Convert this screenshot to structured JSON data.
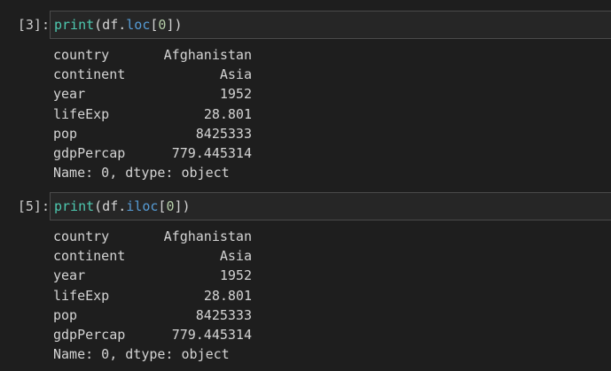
{
  "cells": [
    {
      "prompt": "[3]:",
      "code": {
        "fn": "print",
        "open": "(df.",
        "attr": "loc",
        "bracket_open": "[",
        "index": "0",
        "close": "])"
      },
      "rows": [
        {
          "key": "country",
          "value": "Afghanistan"
        },
        {
          "key": "continent",
          "value": "Asia"
        },
        {
          "key": "year",
          "value": "1952"
        },
        {
          "key": "lifeExp",
          "value": "28.801"
        },
        {
          "key": "pop",
          "value": "8425333"
        },
        {
          "key": "gdpPercap",
          "value": "779.445314"
        }
      ],
      "footer": "Name: 0, dtype: object"
    },
    {
      "prompt": "[5]:",
      "code": {
        "fn": "print",
        "open": "(df.",
        "attr": "iloc",
        "bracket_open": "[",
        "index": "0",
        "close": "])"
      },
      "rows": [
        {
          "key": "country",
          "value": "Afghanistan"
        },
        {
          "key": "continent",
          "value": "Asia"
        },
        {
          "key": "year",
          "value": "1952"
        },
        {
          "key": "lifeExp",
          "value": "28.801"
        },
        {
          "key": "pop",
          "value": "8425333"
        },
        {
          "key": "gdpPercap",
          "value": "779.445314"
        }
      ],
      "footer": "Name: 0, dtype: object"
    }
  ],
  "colors": {
    "background": "#1e1e1e",
    "code_background": "#262626",
    "function": "#4ec9b0",
    "attribute": "#569cd6",
    "number": "#b5cea8",
    "text": "#d4d4d4"
  }
}
